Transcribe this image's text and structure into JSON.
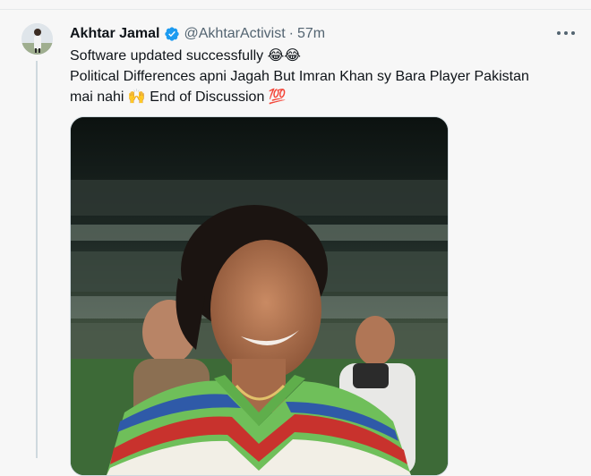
{
  "tweet": {
    "author": {
      "display_name": "Akhtar Jamal",
      "handle": "@AkhtarActivist",
      "verified": true,
      "avatar_icon": "user-avatar"
    },
    "separator": "·",
    "time": "57m",
    "text_lines": [
      "Software updated successfully 😂😂",
      "Political Differences apni Jagah But Imran Khan sy Bara Player Pakistan",
      "mai nahi 🙌 End of Discussion 💯"
    ],
    "media": {
      "kind": "photo"
    },
    "icons": {
      "verified": "verified-badge-icon",
      "more": "more-options-icon"
    },
    "colors": {
      "verified": "#1d9bf0",
      "secondary_text": "#536471",
      "text": "#0f1419"
    }
  }
}
